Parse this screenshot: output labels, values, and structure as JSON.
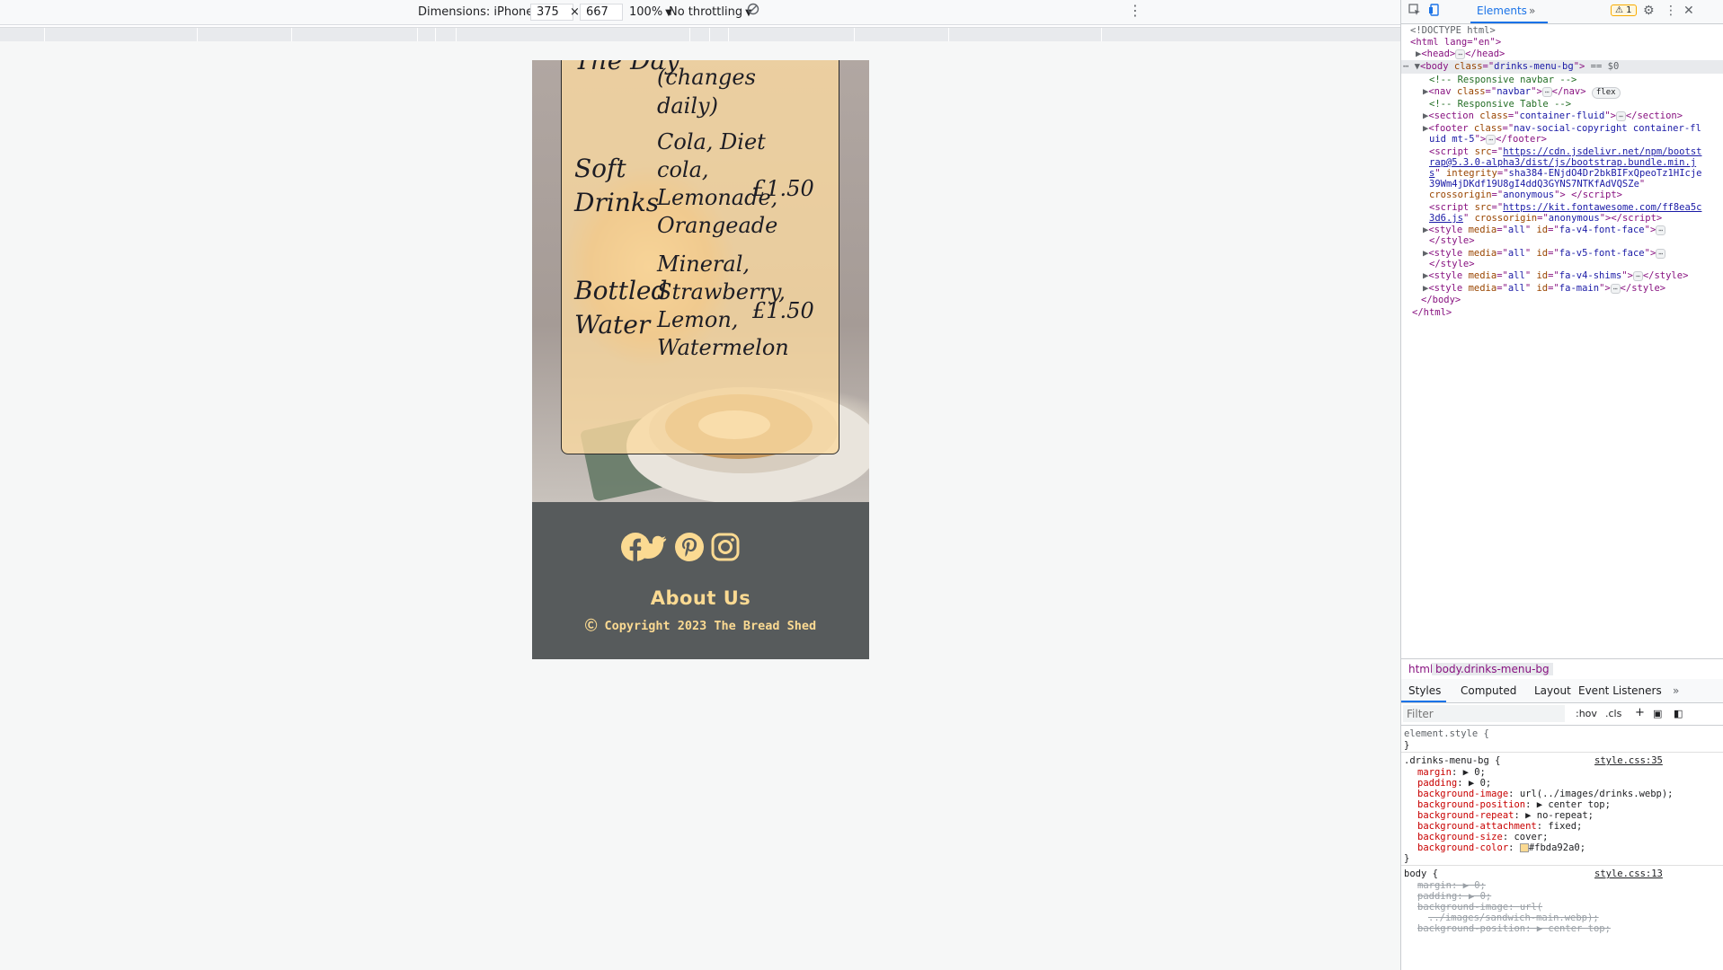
{
  "toolbar": {
    "dimensions_label": "Dimensions: iPhone SE",
    "width_value": "375",
    "times_sign": "×",
    "height_value": "667",
    "zoom_label": "100%",
    "throttling_label": "No throttling"
  },
  "menu": {
    "rows": [
      {
        "name": "The Day",
        "desc": "(changes daily)",
        "price": ""
      },
      {
        "name": "Soft Drinks",
        "desc": "Cola, Diet cola, Lemonade, Orangeade",
        "price": "£1.50"
      },
      {
        "name": "Bottled Water",
        "desc": "Mineral, Strawberry, Lemon, Watermelon",
        "price": "£1.50"
      }
    ],
    "row0_desc_line1": "(changes",
    "row0_desc_line2": "daily)",
    "row0_name_partial": "The Day",
    "row1_name_line1": "Soft",
    "row1_name_line2": "Drinks",
    "row1_desc_lines": [
      "Cola, Diet",
      "cola,",
      "Lemonade,",
      "Orangeade"
    ],
    "row1_price": "£1.50",
    "row2_name_line1": "Bottled",
    "row2_name_line2": "Water",
    "row2_desc_lines": [
      "Mineral,",
      "Strawberry,",
      "Lemon,",
      "Watermelon"
    ],
    "row2_price": "£1.50"
  },
  "footer": {
    "social_icons": [
      "facebook-icon",
      "twitter-icon",
      "pinterest-icon",
      "instagram-icon"
    ],
    "about_label": "About Us",
    "copyright": "Ⓒ Copyright 2023 The Bread Shed",
    "accent_color": "#fbda92",
    "background_color": "#575b5c"
  },
  "devtools": {
    "tab_elements": "Elements",
    "more_tabs": "»",
    "warning_count": "1",
    "dom": {
      "doctype": "<!DOCTYPE html>",
      "html_open": "<html lang=\"en\">",
      "head": "<head>",
      "head_close": "</head>",
      "body_open_class": "drinks-menu-bg",
      "body_eq": "== $0",
      "comment_navbar": "<!-- Responsive navbar -->",
      "nav_class": "navbar",
      "flex_pill": "flex",
      "comment_table": "<!-- Responsive Table -->",
      "section_class": "container-fluid",
      "footer_class_line1": "nav-social-copyright container-fl",
      "footer_class_line2": "uid mt-5",
      "script1_src_l1": "https://cdn.jsdelivr.net/npm/bootst",
      "script1_src_l2": "rap@5.3.0-alpha3/dist/js/bootstrap.bundle.min.j",
      "script1_src_l3": "s",
      "script1_integrity_l1": "sha384-ENjdO4Dr2bkBIFxQpeoTz1HIcje",
      "script1_integrity_l2": "39Wm4jDKdf19U8gI4ddQ3GYNS7NTKfAdVQSZe",
      "script1_crossorigin": "anonymous",
      "script2_src_l1": "https://kit.fontawesome.com/ff8ea5c",
      "script2_src_l2": "3d6.js",
      "script2_crossorigin": "anonymous",
      "style1_id": "fa-v4-font-face",
      "style2_id": "fa-v5-font-face",
      "style3_id": "fa-v4-shims",
      "style4_id": "fa-main",
      "style_media": "all",
      "body_close": "</body>",
      "html_close": "</html>"
    },
    "breadcrumb": [
      "html",
      "body.drinks-menu-bg"
    ],
    "styles_tabs": [
      "Styles",
      "Computed",
      "Layout",
      "Event Listeners",
      "»"
    ],
    "filter_placeholder": "Filter",
    "hov": ":hov",
    "cls": ".cls",
    "styles": {
      "element_style": "element.style {",
      "close_brace": "}",
      "rule1_selector": ".drinks-menu-bg {",
      "rule1_source": "style.css:35",
      "rule1_props": [
        {
          "name": "margin",
          "value": "▶ 0;"
        },
        {
          "name": "padding",
          "value": "▶ 0;"
        },
        {
          "name": "background-image",
          "value": "url(../images/drinks.webp);"
        },
        {
          "name": "background-position",
          "value": "▶ center top;"
        },
        {
          "name": "background-repeat",
          "value": "▶ no-repeat;"
        },
        {
          "name": "background-attachment",
          "value": "fixed;"
        },
        {
          "name": "background-size",
          "value": "cover;"
        },
        {
          "name": "background-color",
          "value": "#fbda92a0;"
        }
      ],
      "rule2_selector": "body {",
      "rule2_source": "style.css:13",
      "rule2_props": [
        {
          "name": "margin",
          "value": "▶ 0;"
        },
        {
          "name": "padding",
          "value": "▶ 0;"
        },
        {
          "name": "background-image",
          "value": "url("
        },
        {
          "name": "",
          "value": "../images/sandwich-main.webp);"
        },
        {
          "name": "background-position",
          "value": "▶ center top;"
        }
      ]
    }
  }
}
